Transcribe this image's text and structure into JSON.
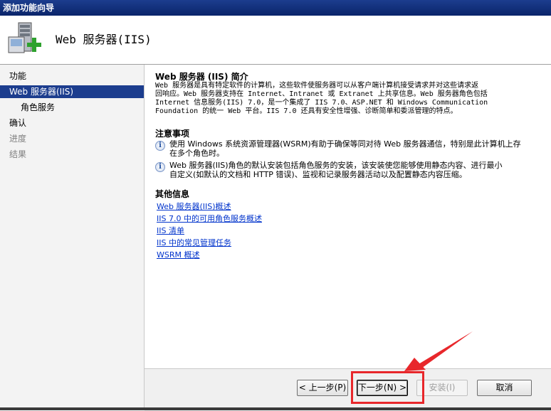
{
  "window": {
    "title": "添加功能向导"
  },
  "header": {
    "title": "Web 服务器(IIS)",
    "icon": "server-role-add-icon"
  },
  "sidebar": {
    "items": [
      {
        "label": "功能",
        "state": "normal"
      },
      {
        "label": "Web 服务器(IIS)",
        "state": "selected"
      },
      {
        "label": "角色服务",
        "state": "sub"
      },
      {
        "label": "确认",
        "state": "normal"
      },
      {
        "label": "进度",
        "state": "disabled"
      },
      {
        "label": "结果",
        "state": "disabled"
      }
    ]
  },
  "content": {
    "intro_title": "Web 服务器 (IIS) 简介",
    "intro_lines": [
      "Web 服务器是具有特定软件的计算机，这些软件使服务器可以从客户端计算机接受请求并对这些请求返",
      "回响应。Web 服务器支持在 Internet、Intranet 或 Extranet 上共享信息。Web 服务器角色包括",
      "Internet 信息服务(IIS) 7.0，是一个集成了 IIS 7.0、ASP.NET 和 Windows Communication",
      "Foundation 的统一 Web 平台。IIS 7.0 还具有安全性增强、诊断简单和委派管理的特点。"
    ],
    "notes_title": "注意事项",
    "notes": [
      {
        "lines": [
          "使用 Windows 系统资源管理器(WSRM)有助于确保等同对待 Web 服务器通信，特别是此计算机上存",
          "在多个角色时。"
        ]
      },
      {
        "lines": [
          "Web 服务器(IIS)角色的默认安装包括角色服务的安装，该安装使您能够使用静态内容、进行最小",
          "自定义(如默认的文档和 HTTP 错误)、监视和记录服务器活动以及配置静态内容压缩。"
        ]
      }
    ],
    "more_title": "其他信息",
    "links": [
      "Web 服务器(IIS)概述",
      "IIS 7.0 中的可用角色服务概述",
      "IIS 清单",
      "IIS 中的常见管理任务",
      "WSRM 概述"
    ]
  },
  "footer": {
    "prev_label": "< 上一步(P)",
    "next_label": "下一步(N) >",
    "install_label": "安装(I)",
    "cancel_label": "取消"
  },
  "colors": {
    "titlebar": "#0a246a",
    "selected": "#1c3d8e",
    "link": "#0033cc",
    "annotation": "#e8272b"
  }
}
